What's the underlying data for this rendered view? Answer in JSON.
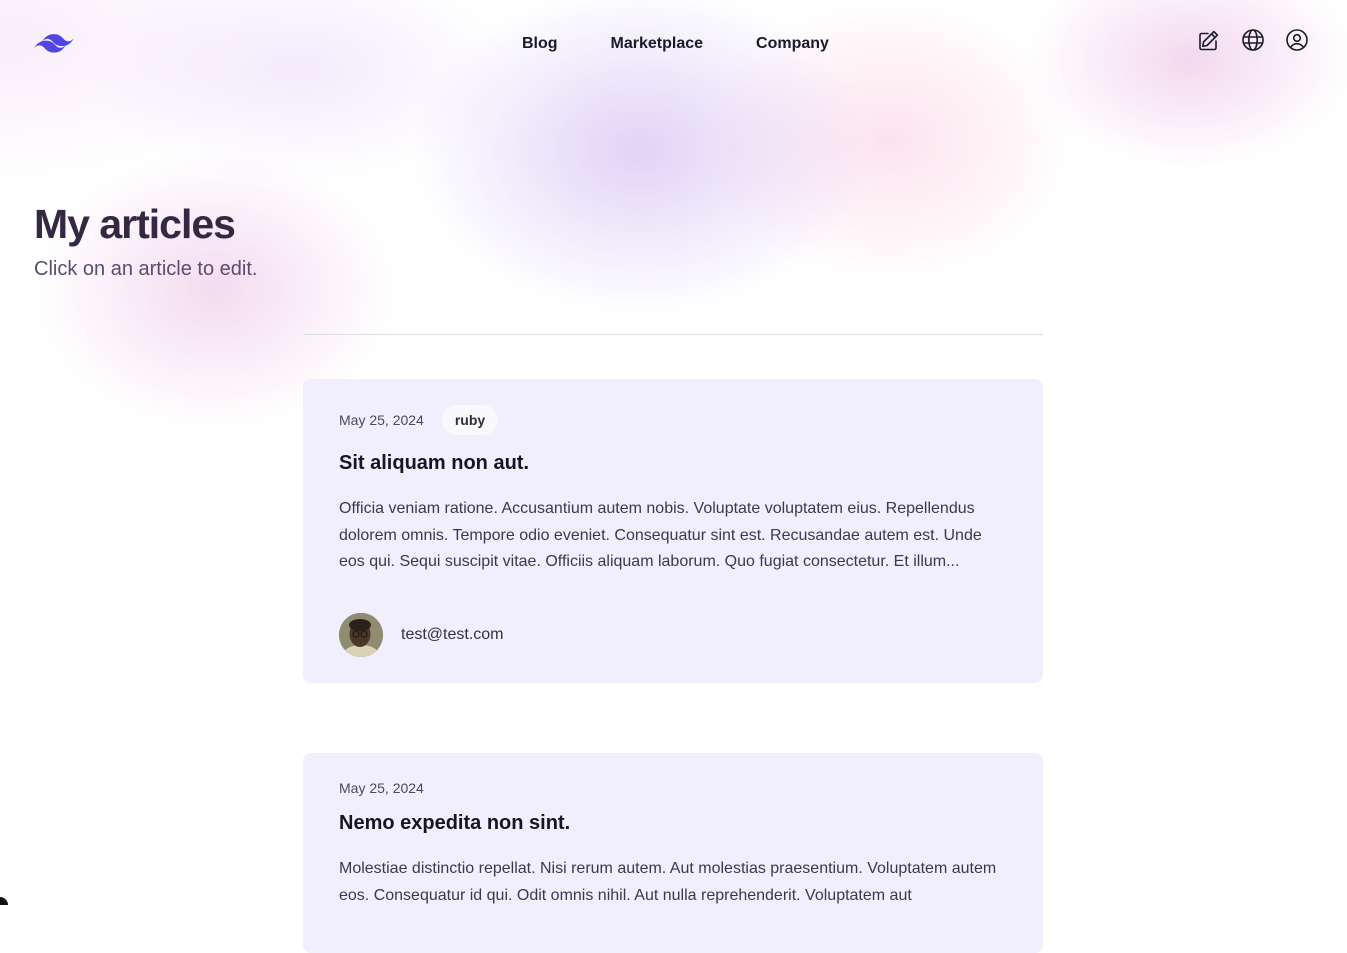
{
  "header": {
    "logo_icon": "tailwind-wave-logo",
    "nav": [
      "Blog",
      "Marketplace",
      "Company"
    ],
    "icons": [
      "edit-icon",
      "globe-icon",
      "user-circle-icon"
    ]
  },
  "page": {
    "title": "My articles",
    "subtitle": "Click on an article to edit."
  },
  "articles": [
    {
      "date": "May 25, 2024",
      "tag": "ruby",
      "title": "Sit aliquam non aut.",
      "excerpt": "Officia veniam ratione. Accusantium autem nobis. Voluptate voluptatem eius. Repellendus dolorem omnis. Tempore odio eveniet. Consequatur sint est. Recusandae autem est. Unde eos qui. Sequi suscipit vitae. Officiis aliquam laborum. Quo fugiat consectetur. Et illum...",
      "author": "test@test.com"
    },
    {
      "date": "May 25, 2024",
      "title": "Nemo expedita non sint.",
      "excerpt": "Molestiae distinctio repellat. Nisi rerum autem. Aut molestias praesentium. Voluptatem autem eos. Consequatur id qui. Odit omnis nihil. Aut nulla reprehenderit. Voluptatem aut"
    }
  ],
  "colors": {
    "logo": "#4f46e5",
    "title": "#362743",
    "card_bg": "#f0edfd"
  }
}
